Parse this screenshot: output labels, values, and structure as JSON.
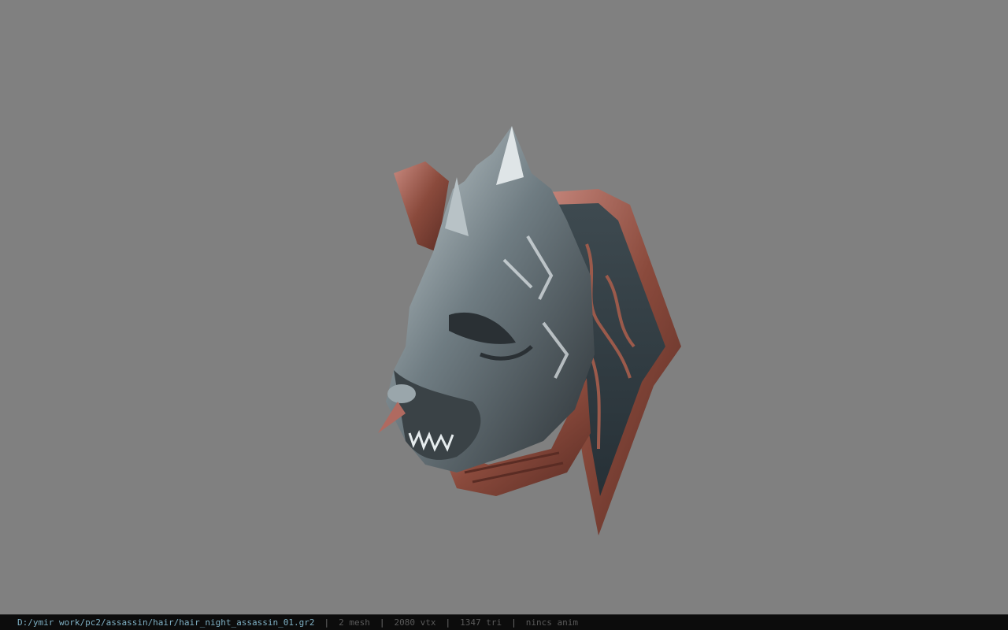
{
  "viewport": {
    "background": "#808080",
    "model_icon": "dragon-helmet-model"
  },
  "status": {
    "file_path": "D:/ymir work/pc2/assassin/hair/hair_night_assassin_01.gr2",
    "separator": "|",
    "mesh": "2 mesh",
    "vtx": "2080 vtx",
    "tri": "1347 tri",
    "anim": "nincs anim"
  }
}
